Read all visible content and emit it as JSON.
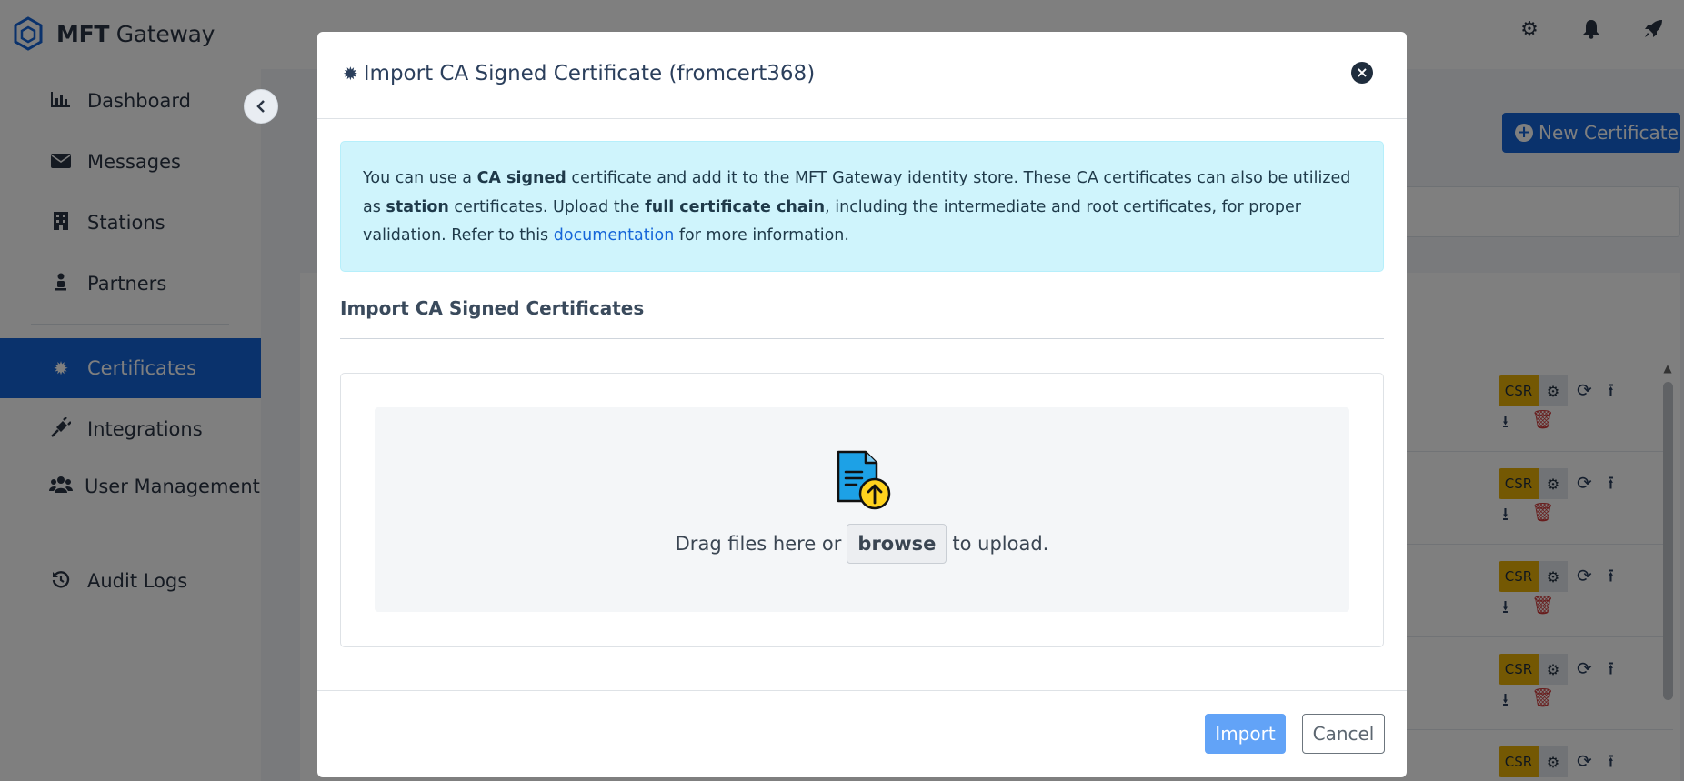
{
  "app": {
    "brand_bold": "MFT",
    "brand_rest": " Gateway",
    "top_icons": [
      "gear-icon",
      "bell-icon",
      "rocket-icon"
    ]
  },
  "sidebar": {
    "items": [
      {
        "label": "Dashboard",
        "icon": "chart-icon"
      },
      {
        "label": "Messages",
        "icon": "envelope-icon"
      },
      {
        "label": "Stations",
        "icon": "building-icon"
      },
      {
        "label": "Partners",
        "icon": "person-icon"
      },
      {
        "label": "Certificates",
        "icon": "certificate-icon",
        "active": true
      },
      {
        "label": "Integrations",
        "icon": "plug-icon"
      },
      {
        "label": "User Management",
        "icon": "users-icon"
      },
      {
        "label": "Audit Logs",
        "icon": "history-icon"
      }
    ]
  },
  "main": {
    "new_certificate_label": "New Certificate",
    "row_actions": {
      "csr_label": "CSR"
    }
  },
  "modal": {
    "title": "Import CA Signed Certificate (fromcert368)",
    "info": {
      "t1": "You can use a ",
      "b1": "CA signed",
      "t2": " certificate and add it to the MFT Gateway identity store. These CA certificates can also be utilized as ",
      "b2": "station",
      "t3": " certificates. Upload the ",
      "b3": "full certificate chain",
      "t4": ", including the intermediate and root certificates, for proper validation. Refer to this ",
      "link": "documentation",
      "t5": " for more information."
    },
    "section_title": "Import CA Signed Certificates",
    "dropzone": {
      "before": "Drag files here or",
      "browse_label": "browse",
      "after": "to upload."
    },
    "import_label": "Import",
    "cancel_label": "Cancel"
  },
  "colors": {
    "primary": "#1565d8",
    "info_bg": "#cff4fc",
    "csr_badge": "#e8b007",
    "delete": "#d13a3a"
  }
}
